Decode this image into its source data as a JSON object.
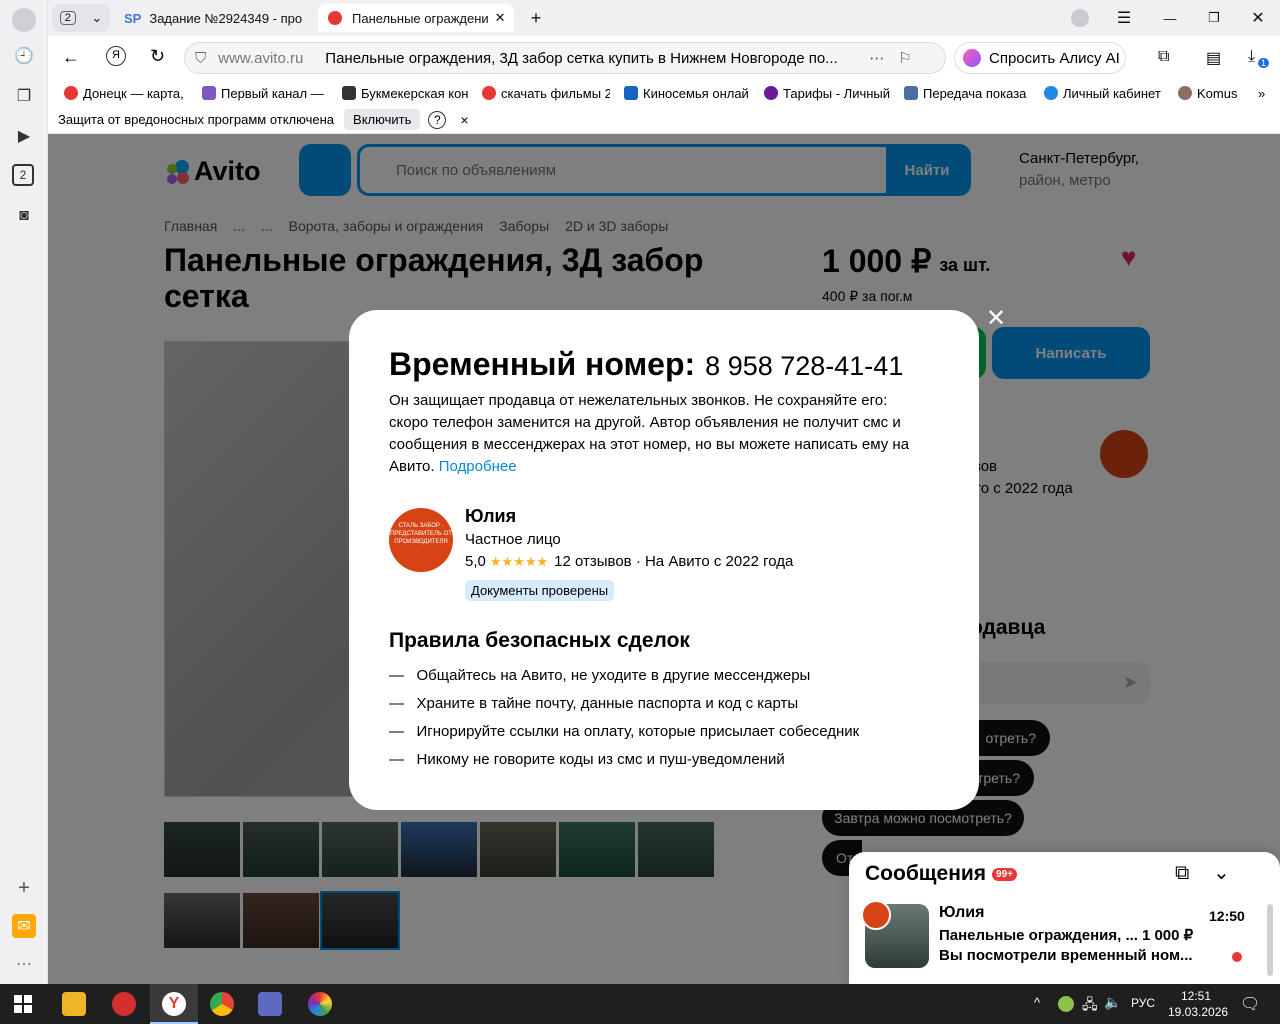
{
  "tabs": {
    "count": "2",
    "tab1_title": "Задание №2924349 - про",
    "tab2_title": "Панельные ограждени"
  },
  "address": {
    "domain": "www.avito.ru",
    "title": "Панельные ограждения, 3Д забор сетка купить в Нижнем Новгороде по...",
    "alice": "Спросить Алису AI",
    "downloads_badge": "1"
  },
  "bookmarks": [
    "Донецк — карта, с",
    "Первый канал — с",
    "Букмекерская кон",
    "скачать фильмы 2",
    "Киносемья онлай",
    "Тарифы - Личный",
    "Передача показа",
    "Личный кабинет",
    "Komus"
  ],
  "infobar": {
    "text": "Защита от вредоносных программ отключена",
    "enable": "Включить",
    "help": "?",
    "close": "×"
  },
  "site": {
    "logo": "Avito",
    "search_placeholder": "Поиск по объявлениям",
    "search_button": "Найти",
    "city": "Санкт-Петербург,",
    "city_sub": "район, метро",
    "breadcrumbs": [
      "Главная",
      "...",
      "...",
      "Ворота, заборы и ограждения",
      "Заборы",
      "2D и 3D заборы"
    ],
    "title_line1": "Панельные ограждения, 3Д забор",
    "title_line2": "сетка",
    "price": "1 000 ₽",
    "price_unit": "за шт.",
    "price_sub": "400 ₽ за пог.м",
    "write_button": "Написать",
    "seller_reviews_frag": "зов",
    "seller_since_frag": "то с 2022 года",
    "ask_heading_frag": "одавца",
    "quick_q1_frag": "отреть?",
    "quick_q2_frag": "треть?",
    "quick_q3": "Завтра можно посмотреть?",
    "quick_q4_frag": "От"
  },
  "modal": {
    "heading": "Временный номер:",
    "phone": "8 958 728-41-41",
    "desc": "Он защищает продавца от нежелательных звонков. Не сохраняйте его: скоро телефон заменится на другой. Автор объявления не получит смс и сообщения в мессенджерах на этот номер, но вы можете написать ему на Авито.",
    "more_link": "Подробнее",
    "seller_name": "Юлия",
    "seller_type": "Частное лицо",
    "rating": "5,0",
    "stars": "★★★★★",
    "reviews": "12 отзывов · На Авито с 2022 года",
    "docs_badge": "Документы проверены",
    "rules_heading": "Правила безопасных сделок",
    "rules": [
      "Общайтесь на Авито, не уходите в другие мессенджеры",
      "Храните в тайне почту, данные паспорта и код с карты",
      "Игнорируйте ссылки на оплату, которые присылает собеседник",
      "Никому не говорите коды из смс и пуш-уведомлений"
    ],
    "avatar_text": "СТАЛЬ ЗАБОР · ПРЕДСТАВИТЕЛЬ ОТ ПРОИЗВОДИТЕЛЯ"
  },
  "messages": {
    "title": "Сообщения",
    "badge": "99+",
    "sender": "Юлия",
    "time": "12:50",
    "item_title": "Панельные ограждения, ...",
    "item_price": "1 000 ₽",
    "preview": "Вы посмотрели временный ном..."
  },
  "taskbar": {
    "lang": "РУС",
    "time": "12:51",
    "date": "19.03.2026"
  },
  "colors": {
    "accent_blue": "#0096f0",
    "green": "#00c853",
    "modal_link": "#0a86d8",
    "heart": "#e0245e",
    "avito_red": "#d84315"
  }
}
